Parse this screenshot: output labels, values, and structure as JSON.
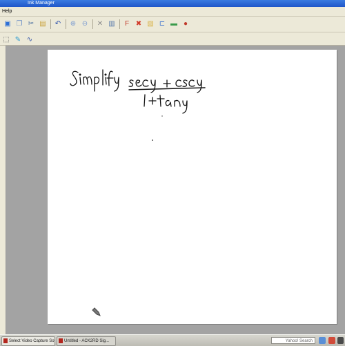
{
  "window": {
    "title": "Ink Manager"
  },
  "menubar": {
    "items": [
      "Help"
    ]
  },
  "toolbar": {
    "buttons": [
      {
        "name": "save",
        "icon": "floppy-icon",
        "color": "#2d6fd6"
      },
      {
        "name": "copy",
        "icon": "copy-icon",
        "color": "#6b8fc7"
      },
      {
        "name": "cut",
        "icon": "scissors-icon",
        "color": "#4a6fa0"
      },
      {
        "name": "paste",
        "icon": "clipboard-icon",
        "color": "#c9a23c"
      },
      {
        "name": "undo",
        "icon": "undo-icon",
        "color": "#1f46a8"
      },
      {
        "name": "zoom-in",
        "icon": "zoom-in-icon",
        "color": "#7a9bd0"
      },
      {
        "name": "zoom-out",
        "icon": "zoom-out-icon",
        "color": "#7a9bd0"
      },
      {
        "name": "delete",
        "icon": "x-icon",
        "color": "#8a8a8a"
      },
      {
        "name": "page",
        "icon": "page-icon",
        "color": "#5577aa"
      },
      {
        "name": "format",
        "icon": "f-icon",
        "color": "#c0392b"
      },
      {
        "name": "tools",
        "icon": "cross-icon",
        "color": "#d13b2a"
      },
      {
        "name": "image",
        "icon": "image-icon",
        "color": "#d9b44a"
      },
      {
        "name": "link",
        "icon": "link-icon",
        "color": "#4b7bd0"
      },
      {
        "name": "screen",
        "icon": "screen-icon",
        "color": "#3a9b4b"
      },
      {
        "name": "record",
        "icon": "record-icon",
        "color": "#c0392b"
      }
    ]
  },
  "toolbar2": {
    "buttons": [
      {
        "name": "select",
        "icon": "select-icon",
        "color": "#666666"
      },
      {
        "name": "pen",
        "icon": "pen-icon",
        "color": "#2a9bd0"
      },
      {
        "name": "lasso",
        "icon": "lasso-icon",
        "color": "#3355aa"
      }
    ]
  },
  "canvas": {
    "ink_color": "#111111",
    "text_simplify": "Simplify",
    "numerator": "secy + cscy",
    "denominator": "1 + tan y"
  },
  "taskbar": {
    "tasks": [
      {
        "label": "Select Video Capture Sof...",
        "icon_color": "#b3261e"
      },
      {
        "label": "Untitled - ACK2RD Sig...",
        "icon_color": "#b3261e"
      }
    ],
    "search_placeholder": "Yahoo! Search"
  }
}
